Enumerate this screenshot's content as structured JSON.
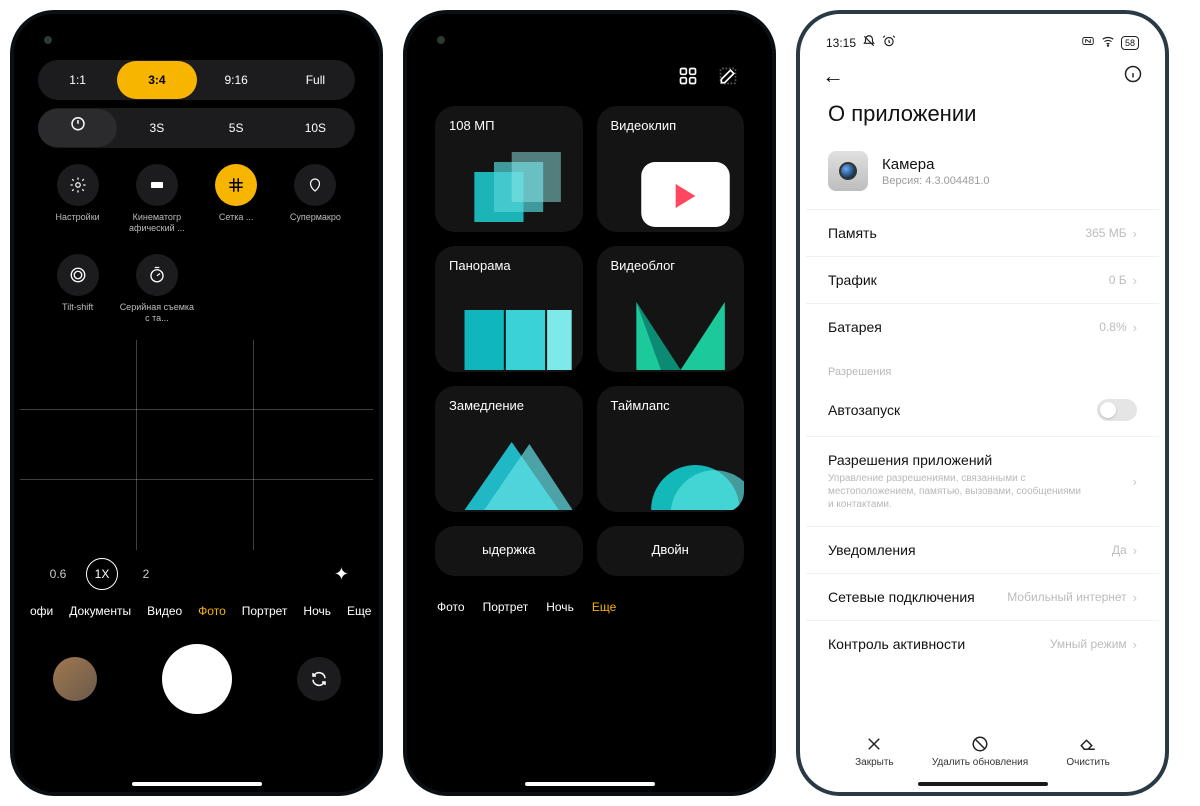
{
  "phone1": {
    "ratios": [
      "1:1",
      "3:4",
      "9:16",
      "Full"
    ],
    "ratio_selected": 1,
    "timers": [
      "",
      "3S",
      "5S",
      "10S"
    ],
    "timer_selected": 0,
    "tools_row1": [
      {
        "name": "settings",
        "label": "Настройки"
      },
      {
        "name": "cinema",
        "label": "Кинематогр\nафический ..."
      },
      {
        "name": "grid",
        "label": "Сетка ..."
      },
      {
        "name": "supermacro",
        "label": "Супермакро"
      }
    ],
    "tool_row1_selected": 2,
    "tools_row2": [
      {
        "name": "tiltshift",
        "label": "Tilt-shift"
      },
      {
        "name": "burst",
        "label": "Серийная\nсъемка с та..."
      }
    ],
    "zooms": [
      "0.6",
      "1X",
      "2"
    ],
    "zoom_selected": 1,
    "modes": [
      "офи",
      "Документы",
      "Видео",
      "Фото",
      "Портрет",
      "Ночь",
      "Еще"
    ],
    "mode_selected": 3
  },
  "phone2": {
    "cards": [
      {
        "id": "108mp",
        "title": "108 МП"
      },
      {
        "id": "videoclip",
        "title": "Видеоклип"
      },
      {
        "id": "panorama",
        "title": "Панорама"
      },
      {
        "id": "vlog",
        "title": "Видеоблог"
      },
      {
        "id": "slowmo",
        "title": "Замедление"
      },
      {
        "id": "timelapse",
        "title": "Таймлапс"
      },
      {
        "id": "exposure",
        "title": "ыдержка"
      },
      {
        "id": "dual",
        "title": "Двойн"
      }
    ],
    "modes": [
      "Фото",
      "Портрет",
      "Ночь",
      "Еще"
    ],
    "mode_selected": 3
  },
  "phone3": {
    "status": {
      "time": "13:15",
      "battery": "58"
    },
    "title": "О приложении",
    "app": {
      "name": "Камера",
      "version": "Версия: 4.3.004481.0"
    },
    "stats": [
      {
        "k": "Память",
        "v": "365 МБ"
      },
      {
        "k": "Трафик",
        "v": "0 Б"
      },
      {
        "k": "Батарея",
        "v": "0.8%"
      }
    ],
    "perm_header": "Разрешения",
    "autostart": "Автозапуск",
    "perm_row": {
      "title": "Разрешения приложений",
      "desc": "Управление разрешениями, связанными с местоположением, памятью, вызовами, сообщениями и контактами."
    },
    "rows2": [
      {
        "k": "Уведомления",
        "v": "Да"
      },
      {
        "k": "Сетевые подключения",
        "v": "Мобильный интернет"
      },
      {
        "k": "Контроль активности",
        "v": "Умный режим"
      }
    ],
    "footer": [
      {
        "id": "close",
        "label": "Закрыть"
      },
      {
        "id": "uninstall",
        "label": "Удалить обновления"
      },
      {
        "id": "clear",
        "label": "Очистить"
      }
    ]
  }
}
